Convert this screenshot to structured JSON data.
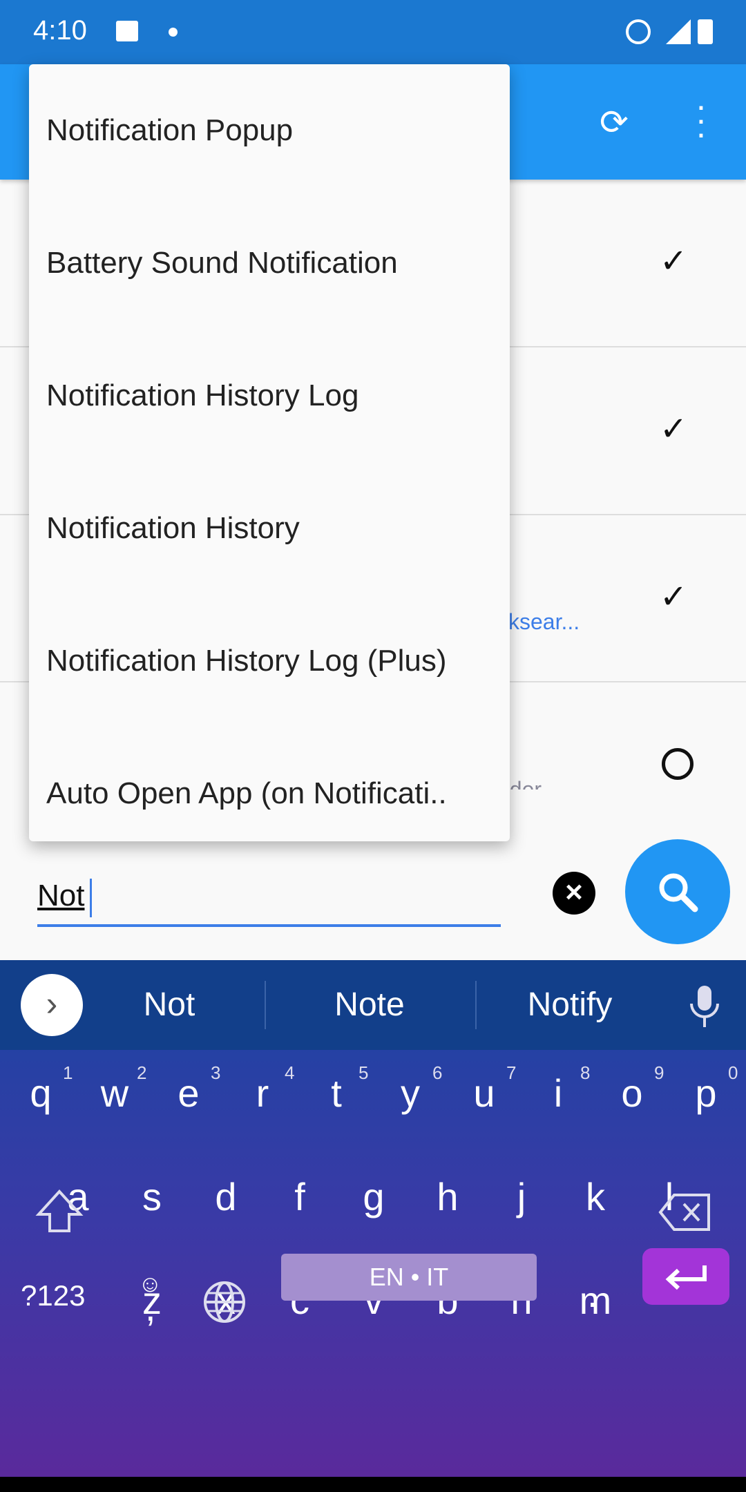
{
  "status": {
    "time": "4:10"
  },
  "menu": {
    "items": [
      "Notification Popup",
      "Battery Sound Notification",
      "Notification History Log",
      "Notification History",
      "Notification History Log (Plus)",
      "Auto Open App (on Notificati.."
    ]
  },
  "list": {
    "row3_link": "cksear...",
    "row4_sub": "nder"
  },
  "search": {
    "value": "Not"
  },
  "keyboard": {
    "suggestions": [
      "Not",
      "Note",
      "Notify"
    ],
    "row1": [
      "q",
      "w",
      "e",
      "r",
      "t",
      "y",
      "u",
      "i",
      "o",
      "p"
    ],
    "row1_hints": [
      "1",
      "2",
      "3",
      "4",
      "5",
      "6",
      "7",
      "8",
      "9",
      "0"
    ],
    "row2": [
      "a",
      "s",
      "d",
      "f",
      "g",
      "h",
      "j",
      "k",
      "l"
    ],
    "row3": [
      "z",
      "x",
      "c",
      "v",
      "b",
      "n",
      "m"
    ],
    "symbols": "?123",
    "comma": ",",
    "space": "EN • IT",
    "period": "."
  },
  "colors": {
    "statusbar": "#1b78d0",
    "appbar": "#2196f3",
    "accent": "#3d7ee8",
    "enter": "#a334d8"
  }
}
